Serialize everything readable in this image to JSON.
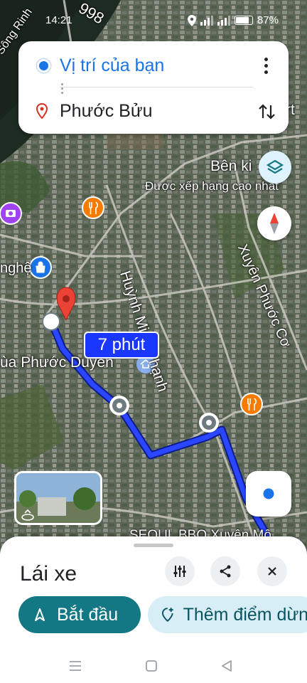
{
  "status_bar": {
    "time": "14:21",
    "battery": "87%"
  },
  "route_card": {
    "origin": "Vị trí của bạn",
    "destination": "Phước Bửu"
  },
  "map": {
    "labels": {
      "road_998": "998",
      "song": "Sông Rinh",
      "ben": "Bên ki",
      "rated": "Được xếp hạng cao nhất",
      "nghe": "nghệ",
      "huynh": "Huỳnh Minh Thạnh",
      "xuyen_phuoc_co": "Xuyên Phước Cơ",
      "chua": "ùa Phước Duyên",
      "seoul": "SEOUL BBQ Xuyên Mộ",
      "rt": "rt"
    },
    "eta": "7 phút"
  },
  "bottom_sheet": {
    "mode": "Lái xe",
    "start_label": "Bắt đầu",
    "add_stop_label": "Thêm điểm dừng"
  },
  "colors": {
    "accent": "#1a73e8",
    "route": "#1a37ff",
    "start": "#137784",
    "add_stop_bg": "#d8eef6"
  }
}
